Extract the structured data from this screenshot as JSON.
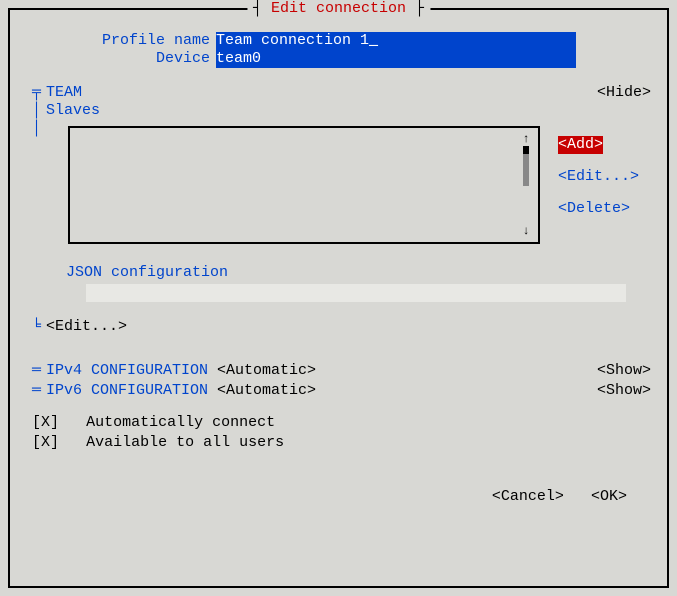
{
  "title": "Edit connection",
  "fields": {
    "profileName": {
      "label": "Profile name",
      "value": "Team connection 1"
    },
    "device": {
      "label": "Device",
      "value": "team0"
    }
  },
  "team": {
    "header": "TEAM",
    "slavesLabel": "Slaves",
    "hideBtn": "<Hide>",
    "addBtn": "<Add>",
    "editBtn": "<Edit...>",
    "deleteBtn": "<Delete>",
    "jsonLabel": "JSON configuration",
    "jsonValue": "",
    "jsonEditBtn": "<Edit...>"
  },
  "ipv4": {
    "label": "IPv4 CONFIGURATION",
    "mode": "<Automatic>",
    "toggle": "<Show>"
  },
  "ipv6": {
    "label": "IPv6 CONFIGURATION",
    "mode": "<Automatic>",
    "toggle": "<Show>"
  },
  "checks": {
    "auto": {
      "mark": "[X]",
      "label": "Automatically connect"
    },
    "all": {
      "mark": "[X]",
      "label": "Available to all users"
    }
  },
  "buttons": {
    "cancel": "<Cancel>",
    "ok": "<OK>"
  }
}
